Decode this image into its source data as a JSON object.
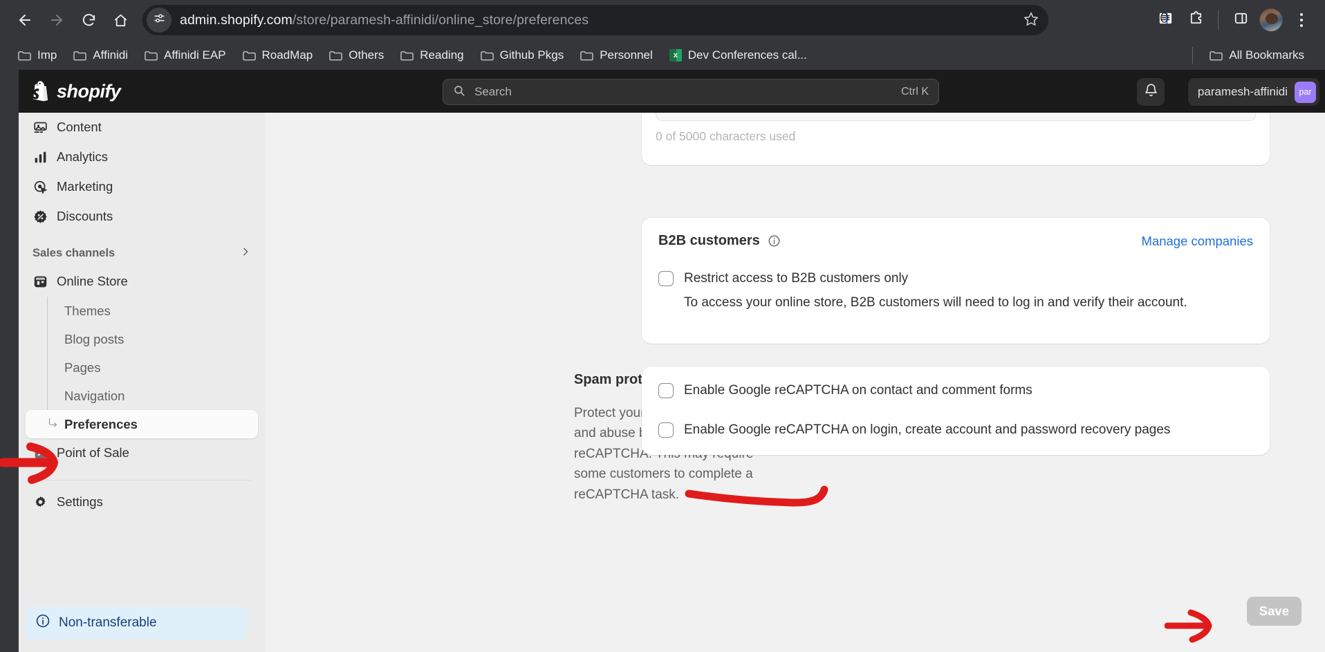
{
  "browser": {
    "nav": {
      "back_icon": "arrow-left-icon",
      "forward_icon": "arrow-right-icon",
      "reload_icon": "reload-icon",
      "home_icon": "home-icon"
    },
    "address": {
      "site_settings_icon": "tune-icon",
      "url_domain": "admin.shopify.com",
      "url_path": "/store/paramesh-affinidi/online_store/preferences",
      "bookmark_icon": "star-icon"
    },
    "toolbar_icons": [
      "reading-list-icon",
      "extensions-puzzle-icon",
      "side-panel-icon",
      "profile-avatar-icon",
      "kebab-menu-icon"
    ],
    "bookmarks": [
      {
        "label": "Imp",
        "icon": "folder-icon"
      },
      {
        "label": "Affinidi",
        "icon": "folder-icon"
      },
      {
        "label": "Affinidi EAP",
        "icon": "folder-icon"
      },
      {
        "label": "RoadMap",
        "icon": "folder-icon"
      },
      {
        "label": "Others",
        "icon": "folder-icon"
      },
      {
        "label": "Reading",
        "icon": "folder-icon"
      },
      {
        "label": "Github Pkgs",
        "icon": "folder-icon"
      },
      {
        "label": "Personnel",
        "icon": "folder-icon"
      },
      {
        "label": "Dev Conferences cal...",
        "icon": "spreadsheet-icon"
      }
    ],
    "all_bookmarks": {
      "label": "All Bookmarks",
      "icon": "folder-icon"
    }
  },
  "topbar": {
    "brand": "shopify",
    "brand_icon": "shopify-bag-icon",
    "search": {
      "icon": "search-icon",
      "placeholder": "Search",
      "shortcut": "Ctrl K"
    },
    "notifications_icon": "bell-icon",
    "account_name": "paramesh-affinidi",
    "account_initials": "par"
  },
  "sidebar": {
    "items": [
      {
        "label": "Content",
        "icon": "image-icon"
      },
      {
        "label": "Analytics",
        "icon": "bar-chart-icon"
      },
      {
        "label": "Marketing",
        "icon": "target-cursor-icon"
      },
      {
        "label": "Discounts",
        "icon": "discount-tag-icon"
      }
    ],
    "section_heading": "Sales channels",
    "section_chevron_icon": "chevron-right-icon",
    "channel": {
      "label": "Online Store",
      "icon": "storefront-icon"
    },
    "sub_items": [
      {
        "label": "Themes",
        "active": false
      },
      {
        "label": "Blog posts",
        "active": false
      },
      {
        "label": "Pages",
        "active": false
      },
      {
        "label": "Navigation",
        "active": false
      },
      {
        "label": "Preferences",
        "active": true
      }
    ],
    "point_of_sale": {
      "label": "Point of Sale",
      "icon": "pos-bag-icon"
    },
    "settings": {
      "label": "Settings",
      "icon": "gear-icon"
    },
    "status_badge": {
      "label": "Non-transferable",
      "icon": "info-circle-icon"
    }
  },
  "main": {
    "description_field": {
      "characters_used": "0 of 5000 characters used"
    },
    "b2b": {
      "title": "B2B customers",
      "info_icon": "info-circle-icon",
      "manage_link": "Manage companies",
      "checkbox_label": "Restrict access to B2B customers only",
      "helper_text": "To access your online store, B2B customers will need to log in and verify their account."
    },
    "spam": {
      "title": "Spam protection",
      "description": "Protect your store from spam and abuse by enabling Google reCAPTCHA. This may require some customers to complete a reCAPTCHA task.",
      "checkbox_1": "Enable Google reCAPTCHA on contact and comment forms",
      "checkbox_2": "Enable Google reCAPTCHA on login, create account and password recovery pages"
    },
    "save_label": "Save"
  },
  "annotations": {
    "color": "#e01b1b",
    "arrow_preferences": "red-arrow-pointing-at-preferences",
    "arrow_save": "red-arrow-pointing-at-save-button",
    "underline_recaptcha": "red-underline-under-login-recaptcha-checkbox"
  },
  "colors": {
    "shopify_dark": "#1a1a1a",
    "sidebar_bg": "#ebebeb",
    "content_bg": "#f1f1f1",
    "link_blue": "#1f6fde",
    "badge_bg": "#e0f0fa",
    "badge_text": "#15417e",
    "avatar_purple": "#9b7cf7",
    "annotation_red": "#e01b1b"
  }
}
